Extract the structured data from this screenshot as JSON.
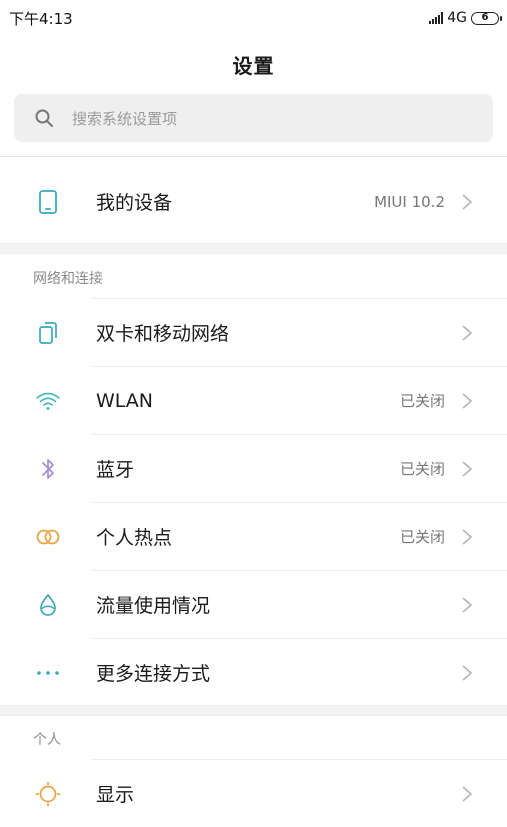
{
  "status_bar": {
    "time": "下午4:13",
    "network": "4G",
    "battery": "6"
  },
  "page_title": "设置",
  "search": {
    "placeholder": "搜索系统设置项"
  },
  "my_device": {
    "label": "我的设备",
    "value": "MIUI 10.2"
  },
  "sections": {
    "network": {
      "header": "网络和连接",
      "items": [
        {
          "label": "双卡和移动网络",
          "value": ""
        },
        {
          "label": "WLAN",
          "value": "已关闭"
        },
        {
          "label": "蓝牙",
          "value": "已关闭"
        },
        {
          "label": "个人热点",
          "value": "已关闭"
        },
        {
          "label": "流量使用情况",
          "value": ""
        },
        {
          "label": "更多连接方式",
          "value": ""
        }
      ]
    },
    "personal": {
      "header": "个人",
      "items": [
        {
          "label": "显示",
          "value": ""
        }
      ]
    }
  },
  "colors": {
    "device_icon": "#3aa7c0",
    "sim_icon": "#3aa7c0",
    "wifi_icon": "#4fb8c4",
    "bluetooth_icon": "#a48cd6",
    "hotspot_icon": "#e7a343",
    "data_icon": "#3aa7c0",
    "more_icon": "#3aa7c0",
    "display_icon": "#e7a343"
  }
}
